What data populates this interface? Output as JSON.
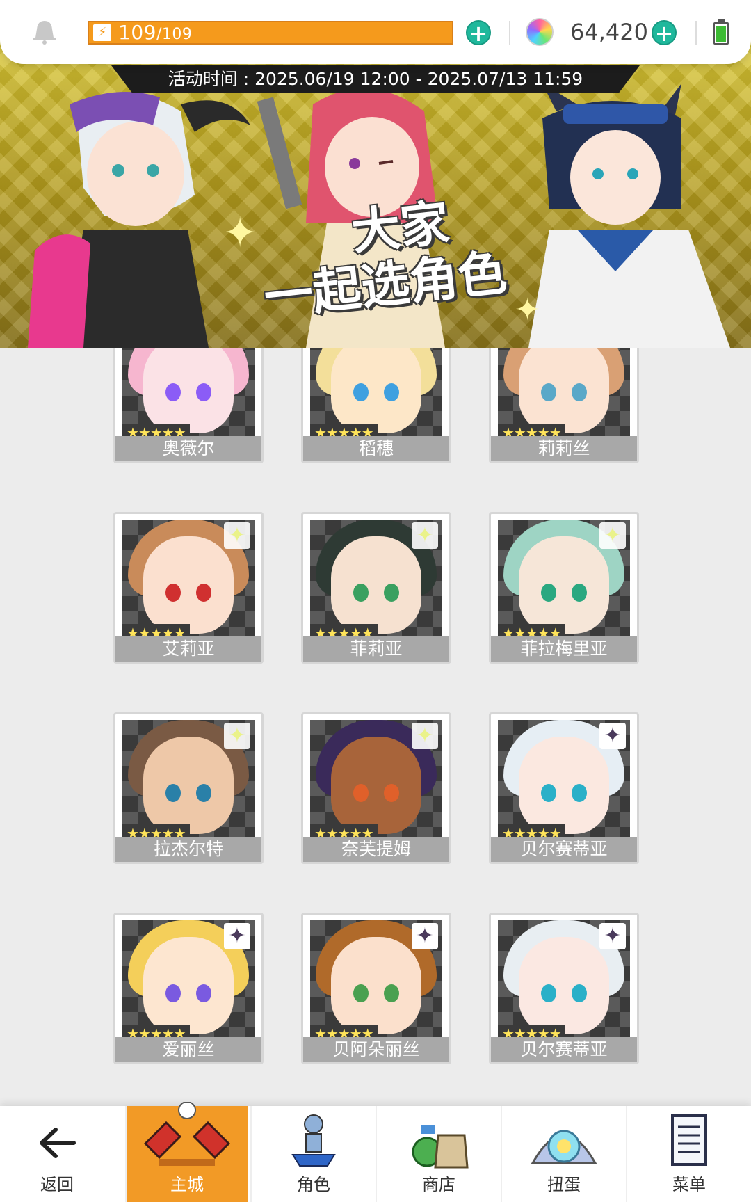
{
  "status_bar": {
    "stamina_current": "109",
    "stamina_max": "/109",
    "stamina_fraction": 1.0,
    "gems": "64,420",
    "bell_icon": "bell-icon",
    "battery_icon": "battery-icon"
  },
  "banner": {
    "event_time": "活动时间 : 2025.06/19 12:00 - 2025.07/13 11:59",
    "title_line1": "大家",
    "title_line2": "一起选角色"
  },
  "characters": [
    {
      "name": "奥薇尔",
      "stars": "★★★★★",
      "badge": "light"
    },
    {
      "name": "稻穗",
      "stars": "★★★★★",
      "badge": "light"
    },
    {
      "name": "莉莉丝",
      "stars": "★★★★★",
      "badge": "light"
    },
    {
      "name": "艾莉亚",
      "stars": "★★★★★",
      "badge": "light"
    },
    {
      "name": "菲莉亚",
      "stars": "★★★★★",
      "badge": "light"
    },
    {
      "name": "菲拉梅里亚",
      "stars": "★★★★★",
      "badge": "light"
    },
    {
      "name": "拉杰尔特",
      "stars": "★★★★★",
      "badge": "light"
    },
    {
      "name": "奈芙提姆",
      "stars": "★★★★★",
      "badge": "light"
    },
    {
      "name": "贝尔赛蒂亚",
      "stars": "★★★★★",
      "badge": "dark"
    },
    {
      "name": "爱丽丝",
      "stars": "★★★★★",
      "badge": "dark"
    },
    {
      "name": "贝阿朵丽丝",
      "stars": "★★★★★",
      "badge": "dark"
    },
    {
      "name": "贝尔赛蒂亚",
      "stars": "★★★★★",
      "badge": "dark"
    }
  ],
  "bottom_nav": {
    "back": "返回",
    "main_city": "主城",
    "character": "角色",
    "shop": "商店",
    "gacha": "扭蛋",
    "menu": "菜单"
  },
  "colors": {
    "stamina": "#f59a1c",
    "plus": "#1fb89c",
    "nav_active": "#f29a26",
    "name_plate": "#a8a8a8"
  }
}
